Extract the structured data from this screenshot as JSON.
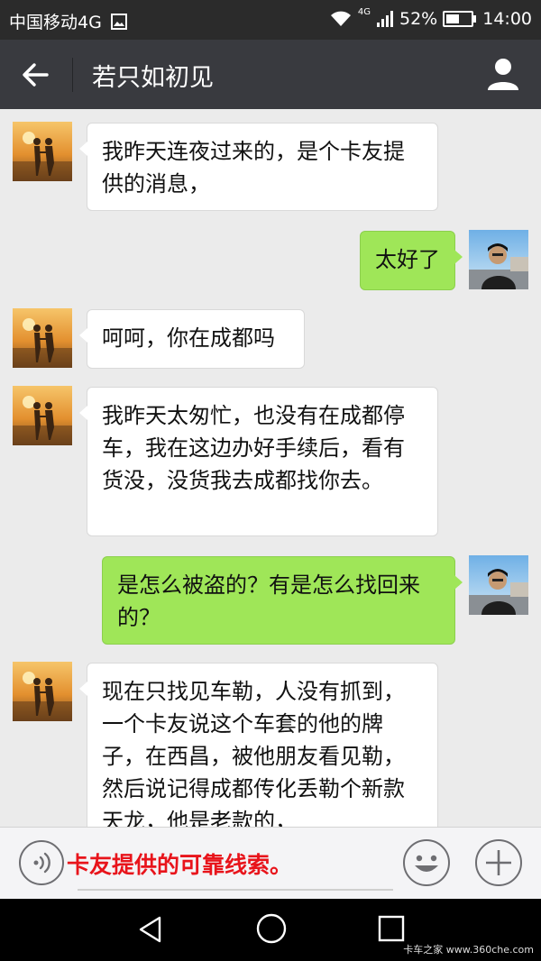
{
  "status_bar": {
    "carrier": "中国移动4G",
    "network": "4G",
    "battery_percent": "52%",
    "battery_level": 0.52,
    "time": "14:00"
  },
  "header": {
    "title": "若只如初见",
    "back_icon": "back-arrow-icon",
    "profile_icon": "person-icon"
  },
  "messages": [
    {
      "side": "in",
      "text": "我昨天连夜过来的，是个卡友提供的消息，",
      "avatar": "couple-sunset-avatar"
    },
    {
      "side": "out",
      "text": "太好了",
      "avatar": "man-photo-avatar"
    },
    {
      "side": "in",
      "text": "呵呵，你在成都吗",
      "avatar": "couple-sunset-avatar"
    },
    {
      "side": "in",
      "text": "我昨天太匆忙，也没有在成都停车，我在这边办好手续后，看有货没，没货我去成都找你去。",
      "avatar": "couple-sunset-avatar"
    },
    {
      "side": "out",
      "text": "是怎么被盗的？有是怎么找回来的？",
      "avatar": "man-photo-avatar"
    },
    {
      "side": "in",
      "text": "现在只找见车勒，人没有抓到，一个卡友说这个车套的他的牌子，在西昌，被他朋友看见勒，然后说记得成都传化丢勒个新款天龙，他是老款的，",
      "avatar": "couple-sunset-avatar"
    }
  ],
  "input_bar": {
    "overlay_caption": "卡友提供的可靠线索。",
    "voice_icon": "voice-icon",
    "emoji_icon": "emoji-icon",
    "plus_icon": "plus-icon"
  },
  "nav_bar": {
    "back_icon": "triangle-back-icon",
    "home_icon": "circle-home-icon",
    "recent_icon": "square-recent-icon",
    "watermark": "卡车之家 www.360che.com"
  },
  "colors": {
    "status_bg": "#2b2b2b",
    "header_bg": "#393a3f",
    "chat_bg": "#ebebeb",
    "bubble_out": "#9fe658",
    "bubble_in": "#ffffff",
    "caption": "#e8141b"
  }
}
